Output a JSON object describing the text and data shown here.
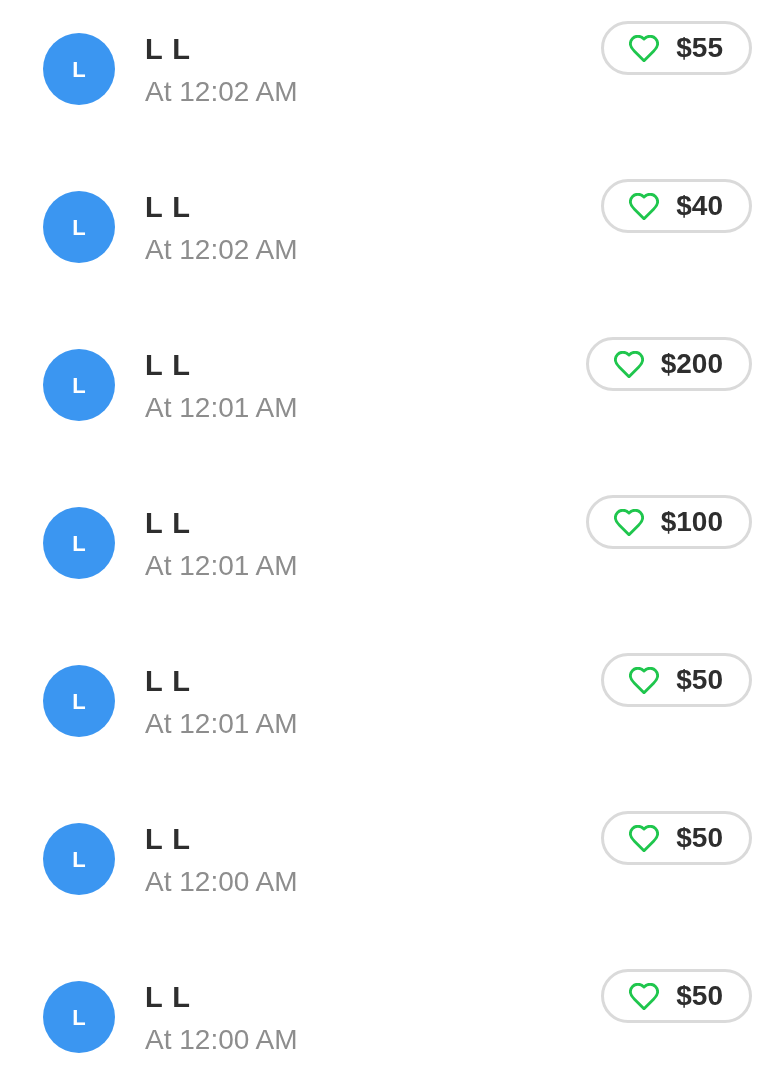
{
  "payments": [
    {
      "avatar_letter": "L",
      "name": "L L",
      "time": "At 12:02 AM",
      "amount": "$55",
      "liked": false
    },
    {
      "avatar_letter": "L",
      "name": "L L",
      "time": "At 12:02 AM",
      "amount": "$40",
      "liked": false
    },
    {
      "avatar_letter": "L",
      "name": "L L",
      "time": "At 12:01 AM",
      "amount": "$200",
      "liked": false
    },
    {
      "avatar_letter": "L",
      "name": "L L",
      "time": "At 12:01 AM",
      "amount": "$100",
      "liked": false
    },
    {
      "avatar_letter": "L",
      "name": "L L",
      "time": "At 12:01 AM",
      "amount": "$50",
      "liked": false
    },
    {
      "avatar_letter": "L",
      "name": "L L",
      "time": "At 12:00 AM",
      "amount": "$50",
      "liked": false
    },
    {
      "avatar_letter": "L",
      "name": "L L",
      "time": "At 12:00 AM",
      "amount": "$50",
      "liked": false
    }
  ]
}
